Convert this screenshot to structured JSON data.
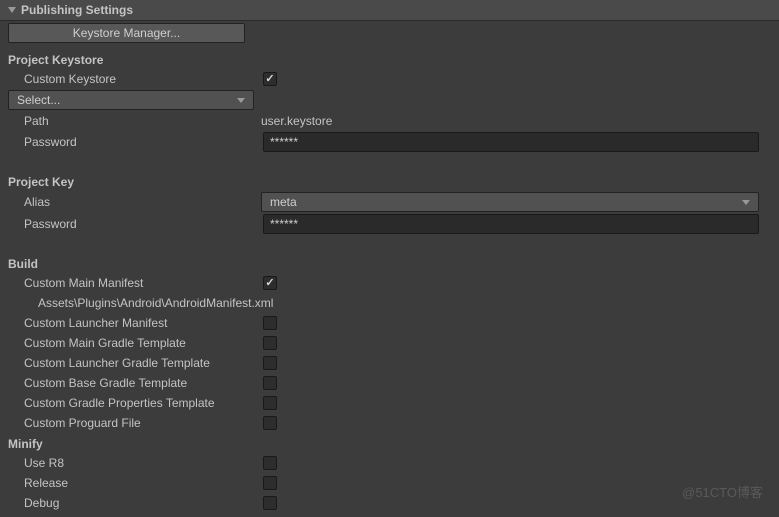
{
  "section": {
    "title": "Publishing Settings"
  },
  "keystoreManager": {
    "label": "Keystore Manager..."
  },
  "projectKeystore": {
    "title": "Project Keystore",
    "customKeystore": {
      "label": "Custom Keystore",
      "checked": true
    },
    "select": {
      "label": "Select..."
    },
    "path": {
      "label": "Path",
      "value": "user.keystore"
    },
    "password": {
      "label": "Password",
      "value": "******"
    }
  },
  "projectKey": {
    "title": "Project Key",
    "alias": {
      "label": "Alias",
      "value": "meta"
    },
    "password": {
      "label": "Password",
      "value": "******"
    }
  },
  "build": {
    "title": "Build",
    "customMainManifest": {
      "label": "Custom Main Manifest",
      "checked": true
    },
    "manifestPath": "Assets\\Plugins\\Android\\AndroidManifest.xml",
    "customLauncherManifest": {
      "label": "Custom Launcher Manifest",
      "checked": false
    },
    "customMainGradle": {
      "label": "Custom Main Gradle Template",
      "checked": false
    },
    "customLauncherGradle": {
      "label": "Custom Launcher Gradle Template",
      "checked": false
    },
    "customBaseGradle": {
      "label": "Custom Base Gradle Template",
      "checked": false
    },
    "customGradleProperties": {
      "label": "Custom Gradle Properties Template",
      "checked": false
    },
    "customProguard": {
      "label": "Custom Proguard File",
      "checked": false
    }
  },
  "minify": {
    "title": "Minify",
    "useR8": {
      "label": "Use R8",
      "checked": false
    },
    "release": {
      "label": "Release",
      "checked": false
    },
    "debug": {
      "label": "Debug",
      "checked": false
    }
  },
  "watermark": "@51CTO博客"
}
